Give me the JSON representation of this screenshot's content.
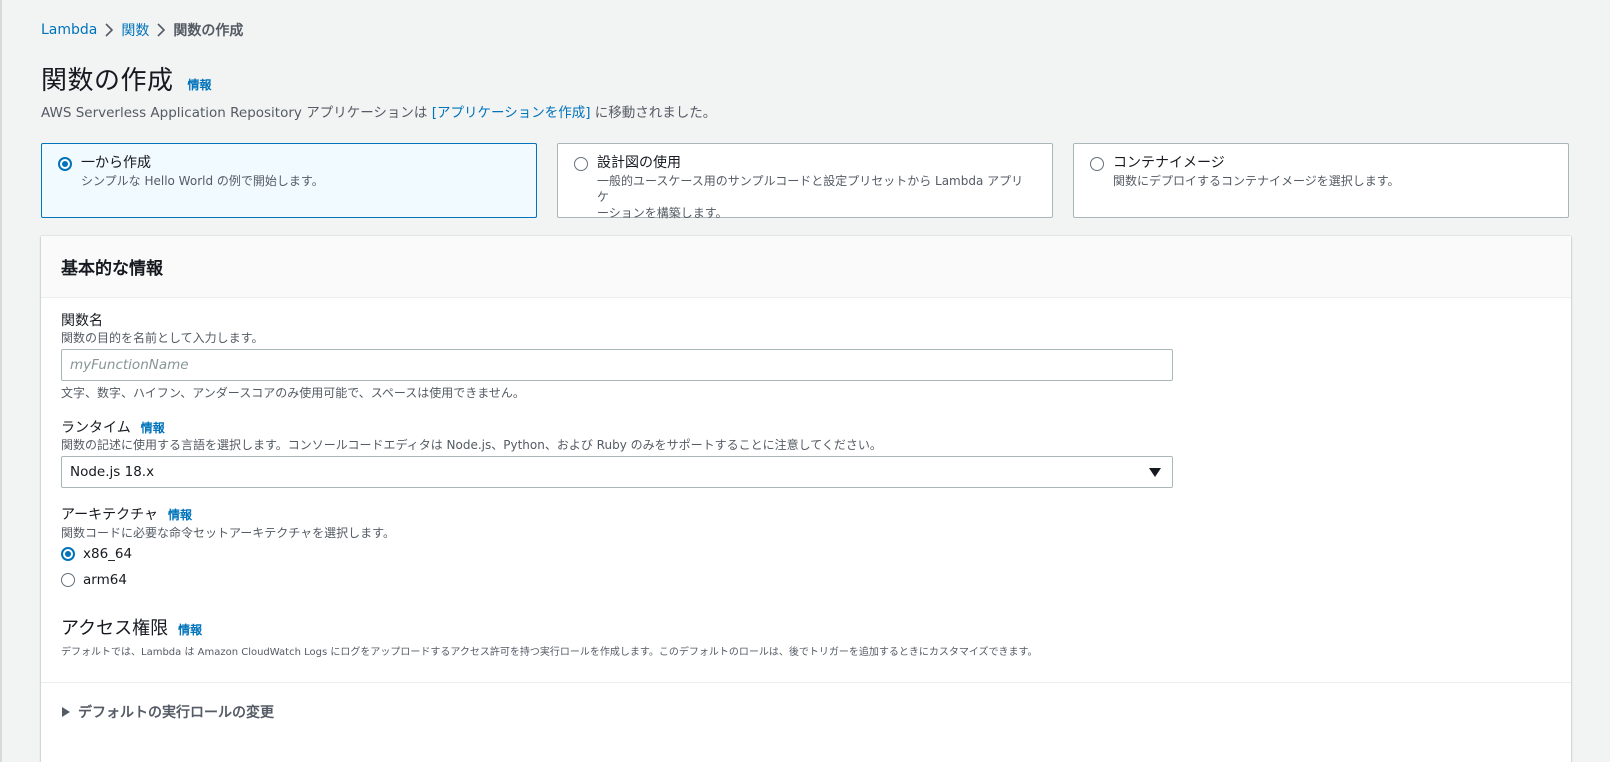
{
  "breadcrumb": {
    "items": [
      {
        "label": "Lambda"
      },
      {
        "label": "関数"
      },
      {
        "label": "関数の作成"
      }
    ]
  },
  "header": {
    "title": "関数の作成",
    "info": "情報",
    "notice_prefix": "AWS Serverless Application Repository アプリケーションは ",
    "notice_link": "[アプリケーションを作成]",
    "notice_suffix": " に移動されました。"
  },
  "options": [
    {
      "title": "一から作成",
      "desc": "シンプルな Hello World の例で開始します。",
      "selected": true
    },
    {
      "title": "設計図の使用",
      "desc_line1": "一般的ユースケース用のサンプルコードと設定プリセットから Lambda アプリケ",
      "desc_line2": "ーションを構築します。",
      "selected": false
    },
    {
      "title": "コンテナイメージ",
      "desc": "関数にデプロイするコンテナイメージを選択します。",
      "selected": false
    }
  ],
  "basic_info": {
    "title": "基本的な情報",
    "function_name": {
      "label": "関数名",
      "desc": "関数の目的を名前として入力します。",
      "placeholder": "myFunctionName",
      "hint": "文字、数字、ハイフン、アンダースコアのみ使用可能で、スペースは使用できません。"
    },
    "runtime": {
      "label": "ランタイム",
      "info": "情報",
      "desc": "関数の記述に使用する言語を選択します。コンソールコードエディタは Node.js、Python、および Ruby のみをサポートすることに注意してください。",
      "value": "Node.js 18.x"
    },
    "architecture": {
      "label": "アーキテクチャ",
      "info": "情報",
      "desc": "関数コードに必要な命令セットアーキテクチャを選択します。",
      "options": [
        {
          "label": "x86_64",
          "checked": true
        },
        {
          "label": "arm64",
          "checked": false
        }
      ]
    },
    "permissions": {
      "title": "アクセス権限",
      "info": "情報",
      "desc": "デフォルトでは、Lambda は Amazon CloudWatch Logs にログをアップロードするアクセス許可を持つ実行ロールを作成します。このデフォルトのロールは、後でトリガーを追加するときにカスタマイズできます。",
      "expander": "デフォルトの実行ロールの変更"
    }
  },
  "colors": {
    "link": "#0073bb",
    "selected_bg": "#f1faff",
    "page_bg": "#f2f3f3"
  }
}
